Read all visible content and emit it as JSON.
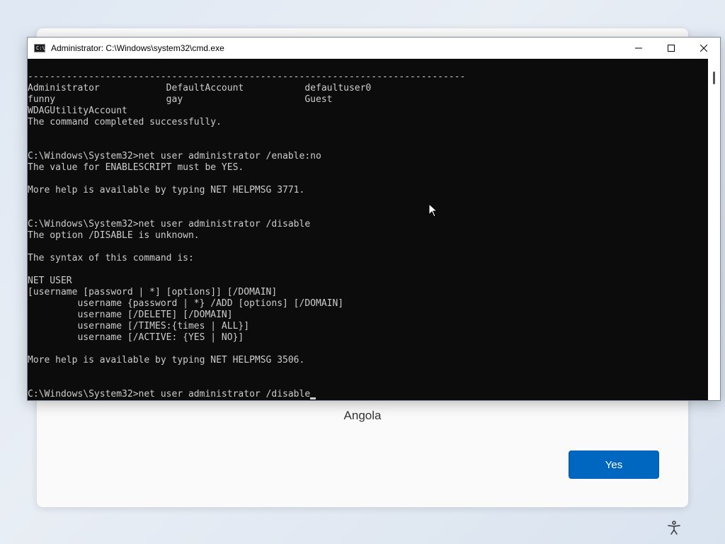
{
  "oobe": {
    "region_value": "Angola",
    "yes_button": "Yes"
  },
  "cmd_window": {
    "title": "Administrator: C:\\Windows\\system32\\cmd.exe",
    "lines": [
      "-------------------------------------------------------------------------------",
      "Administrator            DefaultAccount           defaultuser0",
      "funny                    gay                      Guest",
      "WDAGUtilityAccount",
      "The command completed successfully.",
      "",
      "",
      "C:\\Windows\\System32>net user administrator /enable:no",
      "The value for ENABLESCRIPT must be YES.",
      "",
      "More help is available by typing NET HELPMSG 3771.",
      "",
      "",
      "C:\\Windows\\System32>net user administrator /disable",
      "The option /DISABLE is unknown.",
      "",
      "The syntax of this command is:",
      "",
      "NET USER",
      "[username [password | *] [options]] [/DOMAIN]",
      "         username {password | *} /ADD [options] [/DOMAIN]",
      "         username [/DELETE] [/DOMAIN]",
      "         username [/TIMES:{times | ALL}]",
      "         username [/ACTIVE: {YES | NO}]",
      "",
      "More help is available by typing NET HELPMSG 3506.",
      "",
      "",
      "C:\\Windows\\System32>net user administrator /disable"
    ]
  },
  "icons": {
    "cmd": "cmd-icon",
    "minimize": "minimize-icon",
    "maximize": "maximize-icon",
    "close": "close-icon",
    "accessibility": "accessibility-icon",
    "pointer": "mouse-pointer-icon"
  }
}
